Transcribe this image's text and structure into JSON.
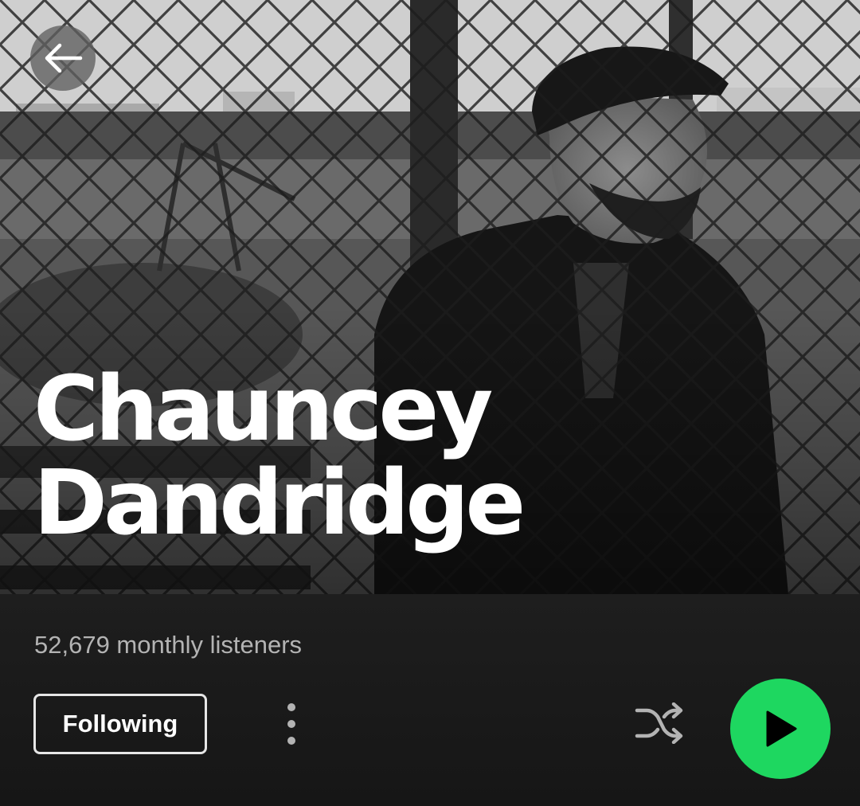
{
  "artist": {
    "name_line1": "Chauncey",
    "name_line2": "Dandridge",
    "monthly_listeners": "52,679 monthly listeners"
  },
  "actions": {
    "follow_label": "Following",
    "back_icon": "arrow-left-icon",
    "more_icon": "more-vertical-icon",
    "shuffle_icon": "shuffle-icon",
    "play_icon": "play-icon"
  },
  "colors": {
    "accent": "#1ed760",
    "background": "#121212",
    "secondary_text": "#b3b3b3"
  }
}
